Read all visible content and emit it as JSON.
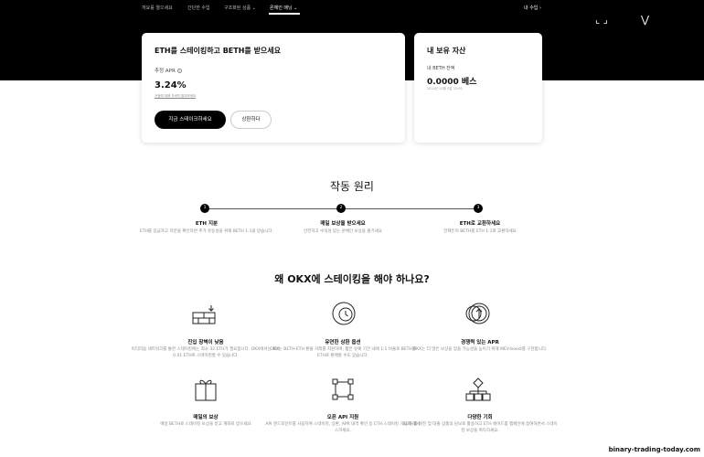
{
  "nav": {
    "items": [
      "개요를 열으세요",
      "간단한 수입",
      "구조화된 상품",
      "온체인 매닝"
    ],
    "right": "내 수입 ›"
  },
  "hero": {
    "deco1": "⌞ ⌟",
    "deco2": "⋁"
  },
  "stake_card": {
    "title": "ETH를 스테이킹하고 BETH를 받으세요",
    "apr_label": "추정 APR",
    "apr_value": "3.24%",
    "apr_note": "규정에 대해 자세히 알아보세요",
    "primary_button": "지금 스테이크하세요",
    "secondary_button": "상환하다"
  },
  "holdings_card": {
    "title": "내 보유 자산",
    "label": "내 BETH 잔액",
    "value": "0.0000 베스",
    "time": "2024년 10월 4일 23:00"
  },
  "how_it_works": {
    "title": "작동 원리",
    "steps": [
      {
        "num": "1",
        "title": "ETH 지분",
        "desc": "ETH를 입금하고 지분을 확인하면 추가 유동성을 위해 BETH 1:1을 받습니다."
      },
      {
        "num": "2",
        "title": "매일 보상을 받으세요",
        "desc": "안전하고 수익성 있는 온체인 보상을 즐기세요"
      },
      {
        "num": "3",
        "title": "ETH로 교환하세요",
        "desc": "언제든지 BETH를 ETH 1:1로 교환하세요"
      }
    ]
  },
  "why": {
    "title": "왜 OKX에 스테이킹을 해야 하나요?",
    "features": [
      {
        "icon": "bricks-icon",
        "title": "진입 장벽이 낮음",
        "desc": "이더리움 네트워크를 통한 스테이킹에는 최소 32 ETH가 필요합니다. OKX에서는 최소 0.01 ETH로 스테이킹할 수 있습니다."
      },
      {
        "icon": "coin-clock-icon",
        "title": "유연한 상환 옵션",
        "desc": "OKX는 BETH-ETH 환율 거래를 지원하며, 짧은 유예 기간 내에 1:1 비율로 BETH를 ETH로 환매할 수도 있습니다."
      },
      {
        "icon": "coins-up-icon",
        "title": "경쟁력 있는 APR",
        "desc": "OKX는 더 많은 보상을 얻을 가능성을 높이기 위해 MEV-boost를 구현합니다."
      },
      {
        "icon": "gift-icon",
        "title": "매일의 보상",
        "desc": "매일 BETH로 스테이킹 보상을 받고 계좌로 받으세요"
      },
      {
        "icon": "api-nodes-icon",
        "title": "오픈 API 지원",
        "desc": "API 엔드포인트를 사용하여 스테이킹, 상환, APR 내역 확인 등 ETH 스테이킹 기능에 액세스하세요."
      },
      {
        "icon": "flow-chart-icon",
        "title": "다양한 기회",
        "desc": "BETH를 마진 및 대출 상품의 담보로 활용하고 ETH 에어드롭 캠페인에 참여하면서 스테이킹 보상을 획득하세요."
      }
    ]
  },
  "watermark": "binary-trading-today.com"
}
